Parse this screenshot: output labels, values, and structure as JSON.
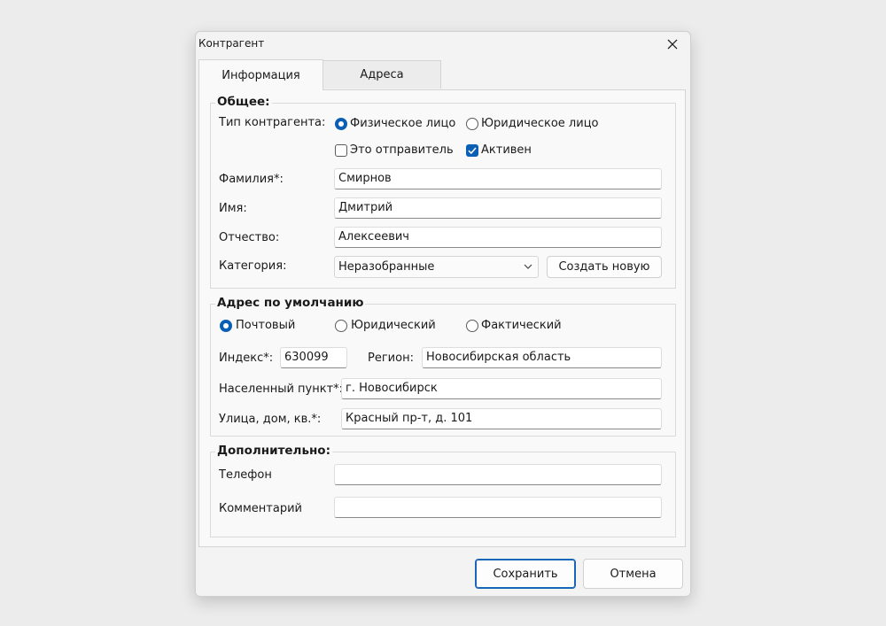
{
  "window": {
    "title": "Контрагент"
  },
  "tabs": [
    {
      "label": "Информация"
    },
    {
      "label": "Адреса"
    }
  ],
  "general": {
    "legend": "Общее:",
    "type_label": "Тип контрагента:",
    "radio_individual": "Физическое лицо",
    "radio_legal": "Юридическое лицо",
    "check_sender": "Это отправитель",
    "check_active": "Активен",
    "surname_label": "Фамилия*:",
    "surname_value": "Смирнов",
    "name_label": "Имя:",
    "name_value": "Дмитрий",
    "patronymic_label": "Отчество:",
    "patronymic_value": "Алексеевич",
    "category_label": "Категория:",
    "category_value": "Неразобранные",
    "create_button": "Создать новую"
  },
  "address": {
    "legend": "Адрес по умолчанию",
    "radio_postal": "Почтовый",
    "radio_legal": "Юридический",
    "radio_actual": "Фактический",
    "index_label": "Индекс*:",
    "index_value": "630099",
    "region_label": "Регион:",
    "region_value": "Новосибирская область",
    "city_label": "Населенный пункт*:",
    "city_value": "г. Новосибирск",
    "street_label": "Улица, дом, кв.*:",
    "street_value": "Красный пр-т, д. 101"
  },
  "extra": {
    "legend": "Дополнительно:",
    "phone_label": "Телефон",
    "phone_value": "",
    "comment_label": "Комментарий",
    "comment_value": ""
  },
  "buttons": {
    "save": "Сохранить",
    "cancel": "Отмена"
  },
  "colors": {
    "accent": "#0a5fb4"
  }
}
